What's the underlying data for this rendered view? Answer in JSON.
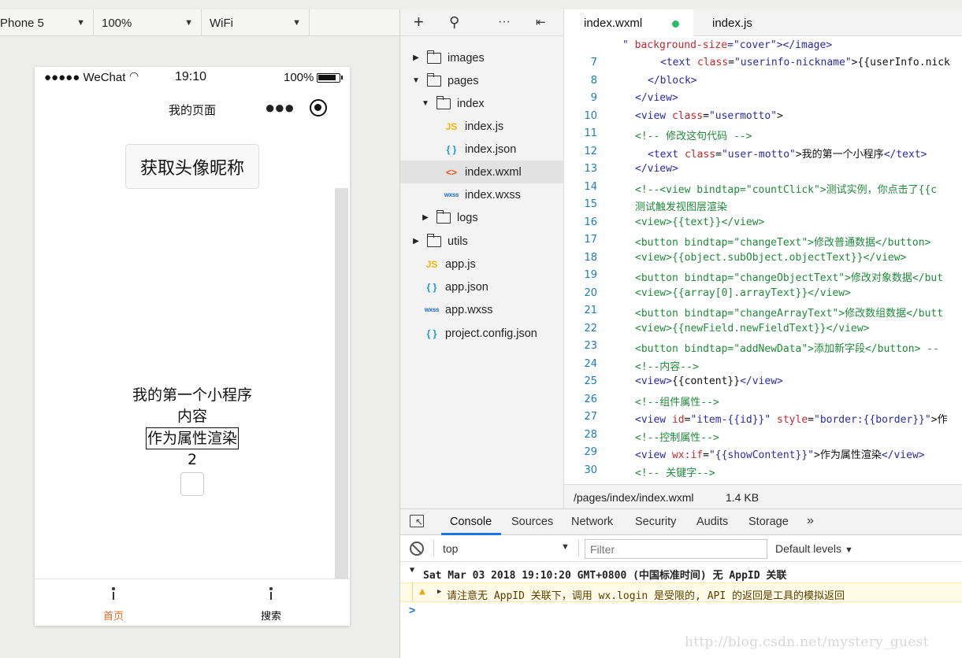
{
  "device_toolbar": {
    "device": "Phone 5",
    "zoom": "100%",
    "network": "WiFi"
  },
  "simulator": {
    "status_bar": {
      "signal": "●●●●● WeChat",
      "time": "19:10",
      "battery_text": "100%"
    },
    "nav_title": "我的页面",
    "avatar_button_label": "获取头像昵称",
    "content": {
      "motto": "我的第一个小程序",
      "content_text": "内容",
      "attr_text": "作为属性渲染",
      "number": "2"
    },
    "tab_bar": [
      {
        "label": "首页"
      },
      {
        "label": "搜索"
      }
    ]
  },
  "explorer": {
    "tree": [
      {
        "label": "images"
      },
      {
        "label": "pages"
      },
      {
        "label": "index"
      },
      {
        "label": "index.js"
      },
      {
        "label": "index.json"
      },
      {
        "label": "index.wxml"
      },
      {
        "label": "index.wxss"
      },
      {
        "label": "logs"
      },
      {
        "label": "utils"
      },
      {
        "label": "app.js"
      },
      {
        "label": "app.json"
      },
      {
        "label": "app.wxss"
      },
      {
        "label": "project.config.json"
      }
    ]
  },
  "editor": {
    "tabs": [
      {
        "label": "index.wxml"
      },
      {
        "label": "index.js"
      }
    ],
    "status_path": "/pages/index/index.wxml",
    "status_size": "1.4 KB"
  },
  "devtools": {
    "tabs": [
      "Console",
      "Sources",
      "Network",
      "Security",
      "Audits",
      "Storage"
    ],
    "context": "top",
    "filter_placeholder": "Filter",
    "levels": "Default levels",
    "log_group": "Sat Mar 03 2018 19:10:20 GMT+0800 (中国标准时间) 无 AppID 关联",
    "warning": "请注意无 AppID 关联下，调用 wx.login 是受限的, API 的返回是工具的模拟返回"
  },
  "watermark": "http://blog.csdn.net/mystery_guest",
  "colors": {
    "accent_tab": "#e06b2a",
    "devtools_blue": "#1a73e8",
    "modified_dot": "#2bbd6e"
  }
}
